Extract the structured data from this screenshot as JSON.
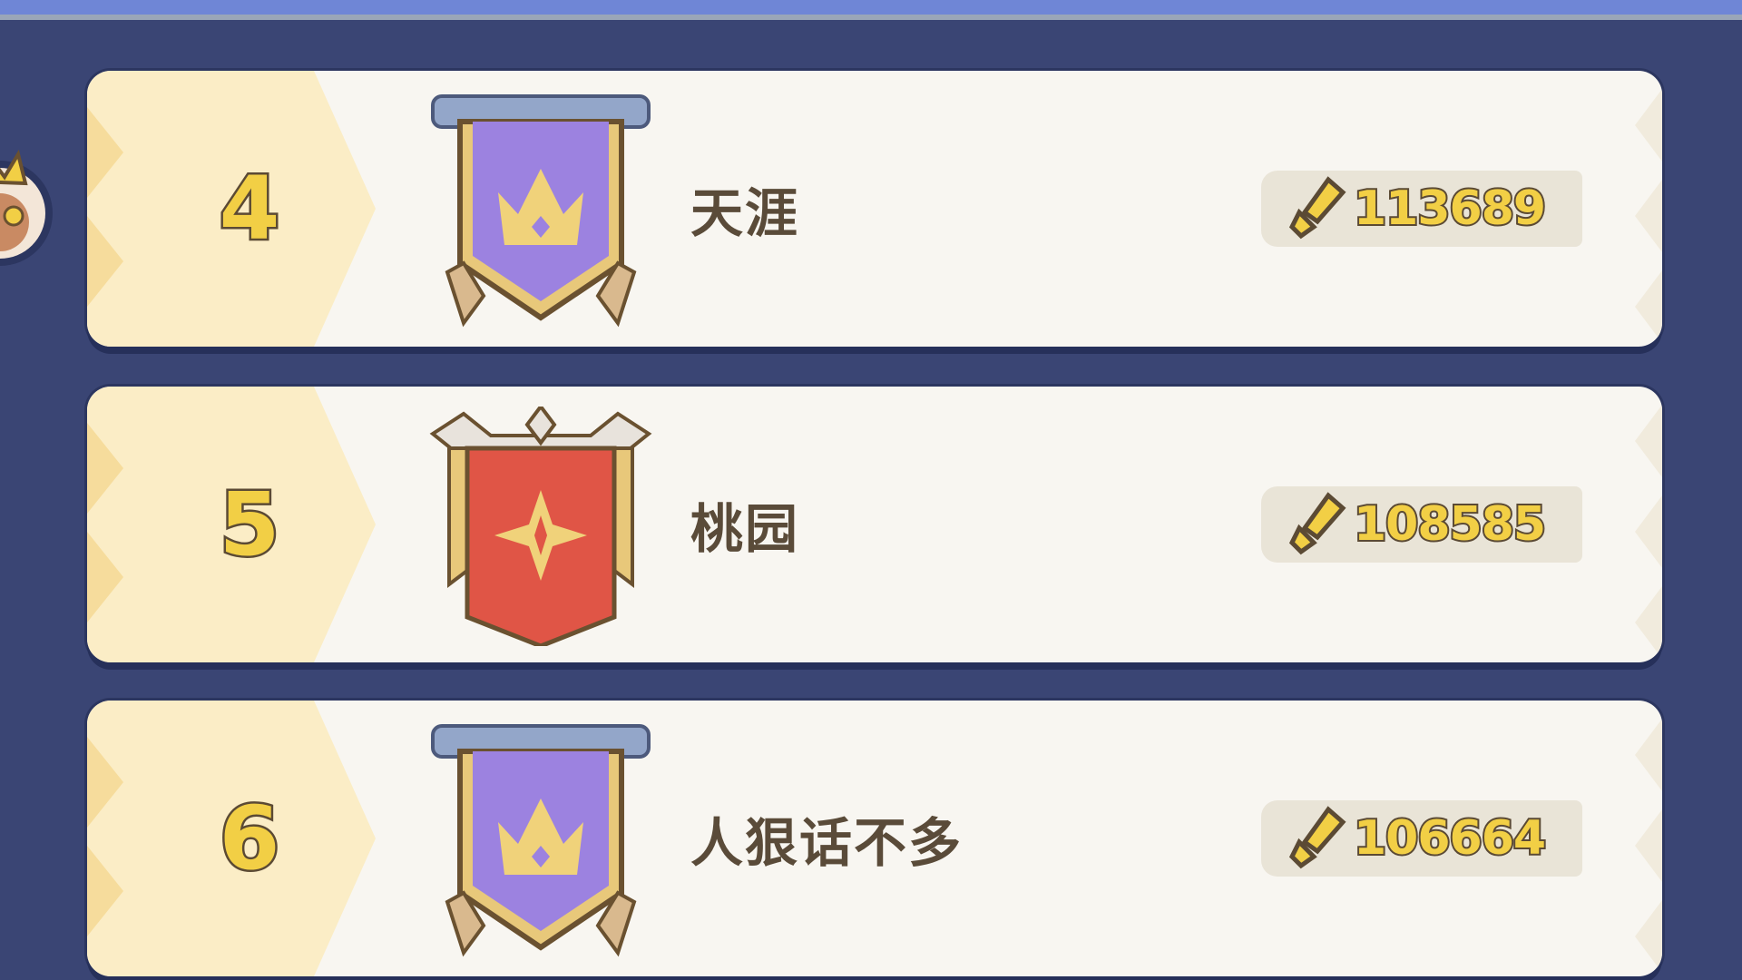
{
  "rankings": [
    {
      "rank": "4",
      "name": "天涯",
      "power": "113689",
      "banner": "purple-crown-banner-icon"
    },
    {
      "rank": "5",
      "name": "桃园",
      "power": "108585",
      "banner": "red-star-banner-icon"
    },
    {
      "rank": "6",
      "name": "人狠话不多",
      "power": "106664",
      "banner": "purple-crown-banner-icon"
    }
  ],
  "icons": {
    "power": "sword-power-icon",
    "avatar": "player-avatar-icon"
  },
  "colors": {
    "background": "#3a4574",
    "row": "#f8f6f1",
    "rank_gold": "#f2cf45",
    "banner_purple": "#9c82e0",
    "banner_red": "#e05546"
  }
}
